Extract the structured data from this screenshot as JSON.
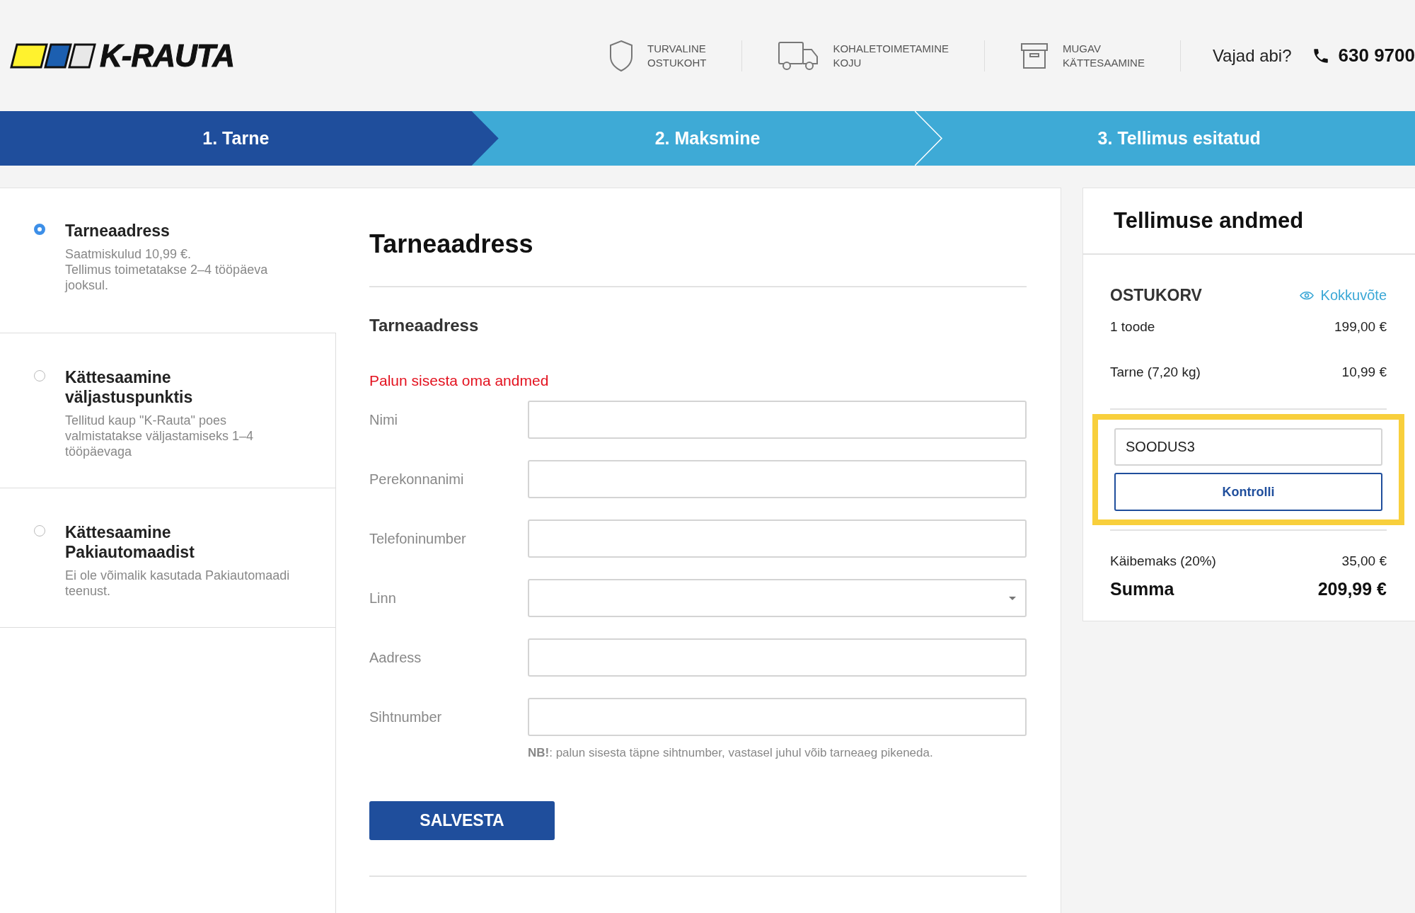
{
  "header": {
    "logo": "K-RAUTA",
    "features": [
      {
        "kind": "shield",
        "text": "TURVALINE\nOSTUKOHT"
      },
      {
        "kind": "truck",
        "text": "KOHALETOIMETAMINE\nKOJU"
      },
      {
        "kind": "box",
        "text": "MUGAV\nKÄTTESAAMINE"
      }
    ],
    "help": {
      "label": "Vajad abi?",
      "phone": "630 9700"
    }
  },
  "steps": [
    {
      "label": "1. Tarne",
      "selected": true
    },
    {
      "label": "2. Maksmine",
      "selected": false
    },
    {
      "label": "3. Tellimus esitatud",
      "selected": false
    }
  ],
  "delivery_options": [
    {
      "title": "Tarneaadress",
      "description": "Saatmiskulud 10,99 €.\nTellimus toimetatakse 2–4 tööpäeva jooksul.",
      "selected": true
    },
    {
      "title": "Kättesaamine väljastuspunktis",
      "description": "Tellitud kaup \"K-Rauta\" poes valmistatakse väljastamiseks 1–4 tööpäevaga",
      "selected": false
    },
    {
      "title": "Kättesaamine Pakiautomaadist",
      "description": "Ei ole võimalik kasutada Pakiautomaadi teenust.",
      "selected": false
    }
  ],
  "form": {
    "title": "Tarneaadress",
    "subtitle": "Tarneaadress",
    "error": "Palun sisesta oma andmed",
    "fields": [
      {
        "label": "Nimi",
        "kind": "text"
      },
      {
        "label": "Perekonnanimi",
        "kind": "text"
      },
      {
        "label": "Telefoninumber",
        "kind": "text"
      },
      {
        "label": "Linn",
        "kind": "select"
      },
      {
        "label": "Aadress",
        "kind": "text"
      },
      {
        "label": "Sihtnumber",
        "kind": "text"
      }
    ],
    "note": "**NB!**: palun sisesta täpne sihtnumber, vastasel juhul võib tarneaeg pikeneda.",
    "button": "SALVESTA"
  },
  "order": {
    "title": "Tellimuse andmed",
    "cart_heading": "OSTUKORV",
    "summary_link": "Kokkuvõte",
    "lines": [
      {
        "label": "1 toode",
        "value": "199,00 €"
      },
      {
        "label": "Tarne (7,20 kg)",
        "value": "10,99 €"
      }
    ],
    "coupon": {
      "value": "SOODUS3",
      "button": "Kontrolli",
      "highlighted": true
    },
    "vat": {
      "label": "Käibemaks (20%)",
      "value": "35,00 €"
    },
    "total": {
      "label": "Summa",
      "value": "209,99 €"
    }
  }
}
